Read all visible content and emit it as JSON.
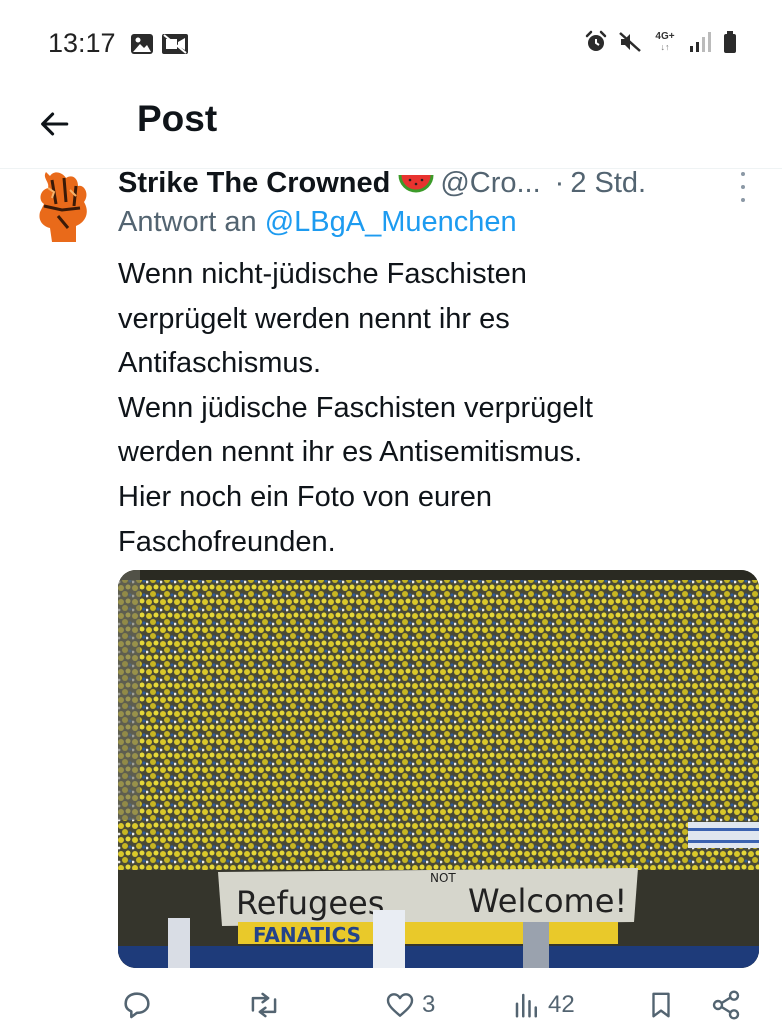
{
  "status_bar": {
    "time": "13:17",
    "network": "4G+",
    "left_icons": [
      "gallery-icon",
      "screen-record-icon"
    ],
    "right_icons": [
      "alarm-icon",
      "mute-icon",
      "network-4g-icon",
      "signal-icon",
      "battery-icon"
    ]
  },
  "header": {
    "title": "Post",
    "back_icon": "arrow-left-icon"
  },
  "post": {
    "author_name": "Strike The Crowned",
    "author_emoji": "watermelon",
    "handle": "@Cro...",
    "separator": "·",
    "time_ago": "2 Std.",
    "reply_prefix": "Antwort an",
    "reply_handle": "@LBgA_Muenchen",
    "text": "Wenn nicht-jüdische Faschisten\nverprügelt werden nennt ihr es\nAntifaschismus.\nWenn jüdische Faschisten verprügelt\nwerden nennt ihr es Antisemitismus.\nHier noch ein Foto von euren\nFaschofreunden.",
    "media": {
      "banner_main_1": "Refugees",
      "banner_insert": "NOT",
      "banner_main_2": "Welcome!",
      "lower_banner": "FANATICS"
    }
  },
  "actions": {
    "reply_count": "",
    "repost_count": "",
    "like_count": "3",
    "view_count": "42"
  },
  "colors": {
    "link": "#1d9bf0",
    "muted": "#536471",
    "text": "#0f1419"
  }
}
